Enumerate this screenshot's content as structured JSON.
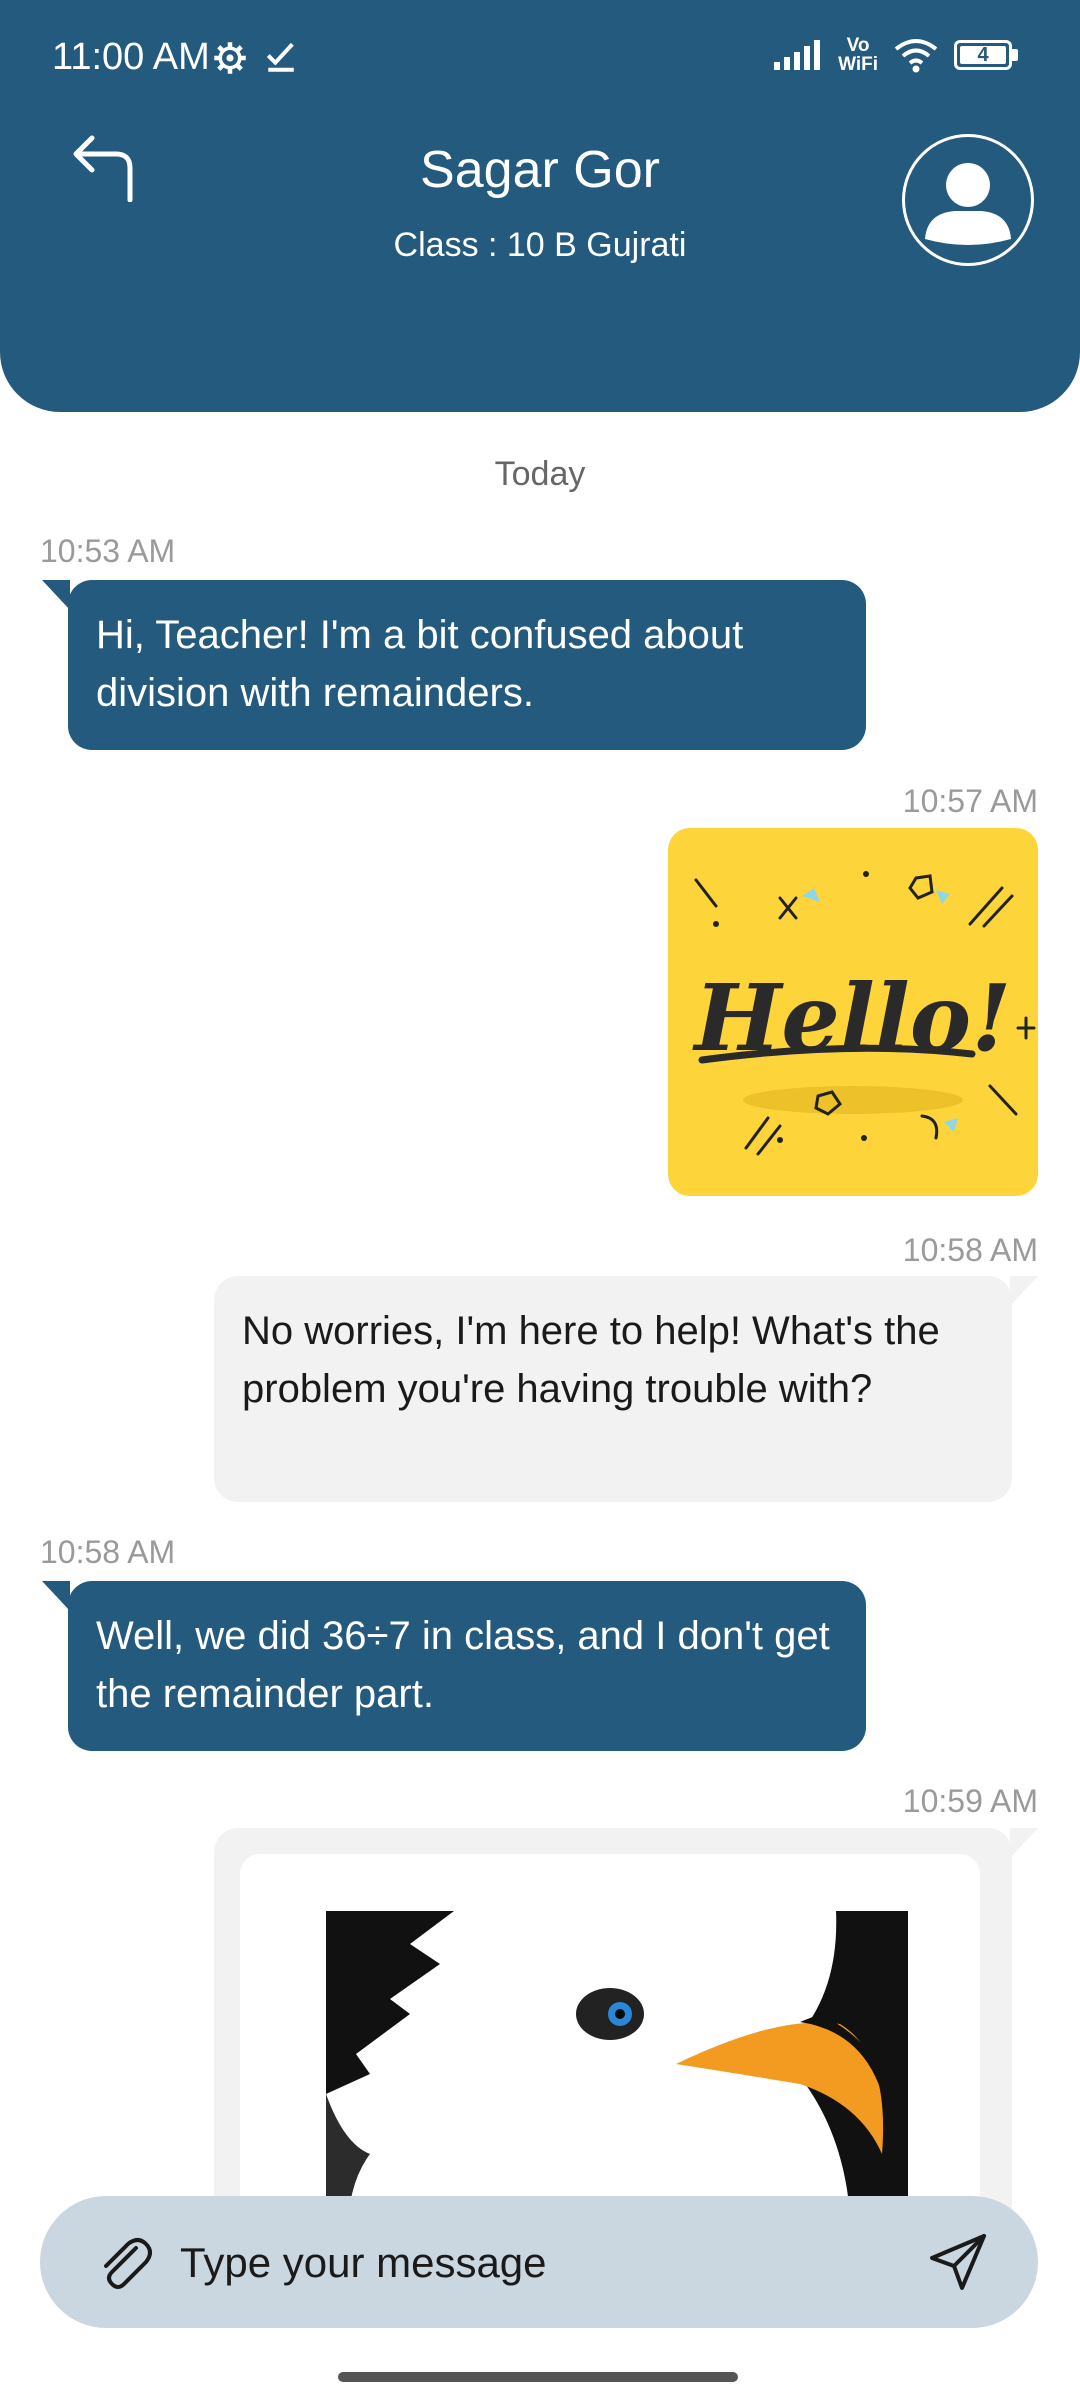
{
  "status_bar": {
    "time": "11:00 AM",
    "battery": "4",
    "network_label_top": "Vo",
    "network_label_bottom": "WiFi"
  },
  "header": {
    "title": "Sagar Gor",
    "subtitle": "Class : 10 B Gujrati"
  },
  "chat": {
    "date_separator": "Today",
    "messages": [
      {
        "time": "10:53 AM",
        "text": "Hi, Teacher! I'm a bit confused about division with remainders."
      },
      {
        "time": "10:57 AM",
        "image": "hello-sticker"
      },
      {
        "time": "10:58 AM",
        "text": "No worries, I'm here to help! What's the problem you're having trouble with?"
      },
      {
        "time": "10:58 AM",
        "text": "Well, we did 36÷7 in class, and I don't get the remainder part."
      },
      {
        "time": "10:59 AM",
        "image": "eagle-picture"
      }
    ]
  },
  "composer": {
    "placeholder": "Type your message"
  },
  "colors": {
    "primary": "#235a7d",
    "incoming_bubble": "#f2f2f2",
    "composer_bg": "#cad6e0",
    "sticker_bg": "#fdd53a"
  }
}
